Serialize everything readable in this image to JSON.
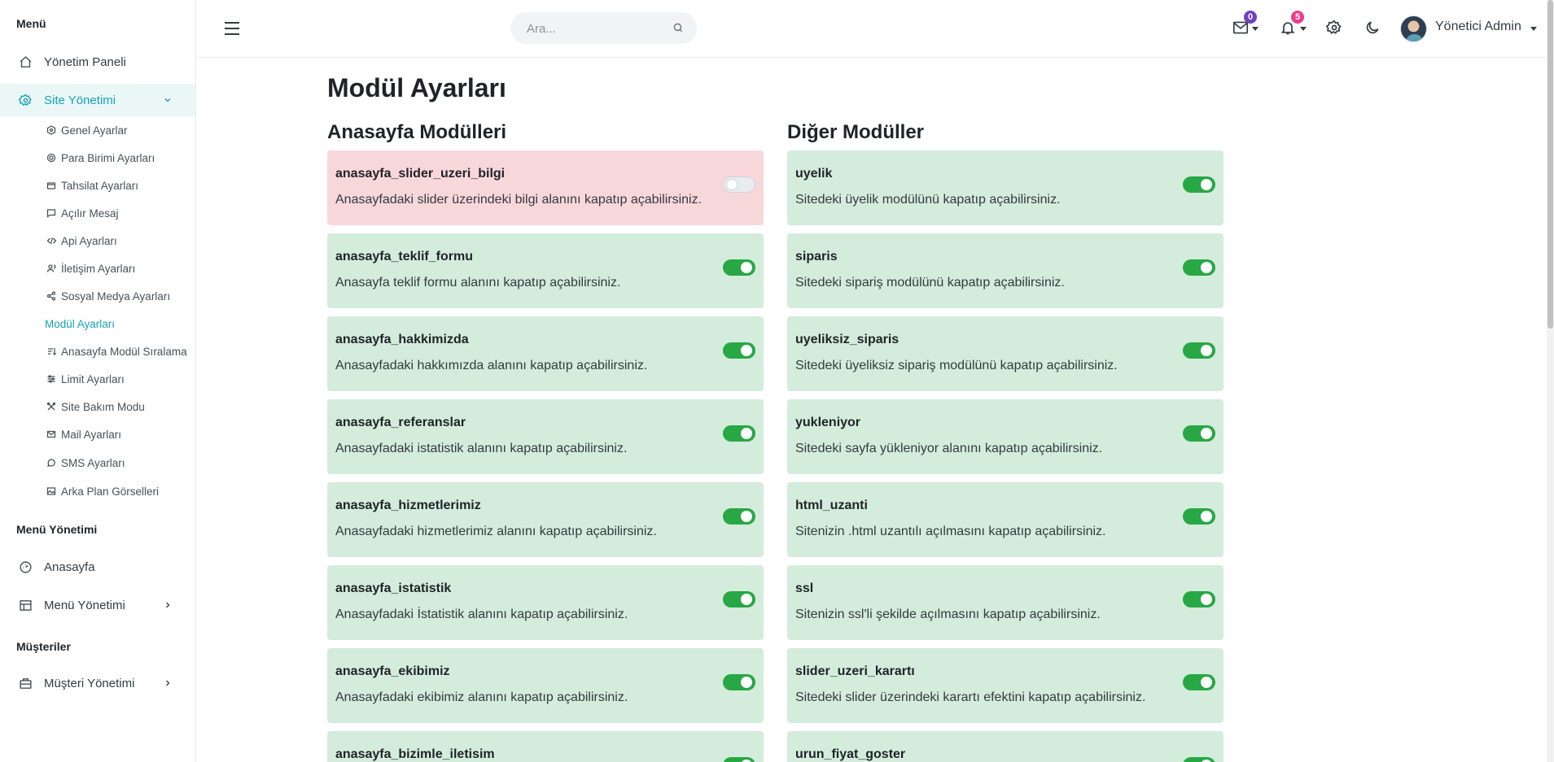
{
  "sidebar": {
    "section_menu": "Menü",
    "dashboard": "Yönetim Paneli",
    "site_management": "Site Yönetimi",
    "sub_items": [
      {
        "label": "Genel Ayarlar",
        "icon": "settings-icon"
      },
      {
        "label": "Para Birimi Ayarları",
        "icon": "currency-icon"
      },
      {
        "label": "Tahsilat Ayarları",
        "icon": "folder-icon"
      },
      {
        "label": "Açılır Mesaj",
        "icon": "message-icon"
      },
      {
        "label": "Api Ayarları",
        "icon": "code-icon"
      },
      {
        "label": "İletişim Ayarları",
        "icon": "users-icon"
      },
      {
        "label": "Sosyal Medya Ayarları",
        "icon": "share-icon"
      },
      {
        "label": "Modül Ayarları",
        "icon": "",
        "active": true
      },
      {
        "label": "Anasayfa Modül Sıralama",
        "icon": "sort-icon"
      },
      {
        "label": "Limit Ayarları",
        "icon": "sliders-icon"
      },
      {
        "label": "Site Bakım Modu",
        "icon": "tools-icon"
      },
      {
        "label": "Mail Ayarları",
        "icon": "mail-icon"
      },
      {
        "label": "SMS Ayarları",
        "icon": "chat-icon"
      },
      {
        "label": "Arka Plan Görselleri",
        "icon": "image-icon"
      }
    ],
    "section_menu_management": "Menü Yönetimi",
    "homepage": "Anasayfa",
    "menu_management": "Menü Yönetimi",
    "section_customers": "Müşteriler",
    "customer_management": "Müşteri Yönetimi"
  },
  "header": {
    "search_placeholder": "Ara...",
    "messages_count": "0",
    "notifications_count": "5",
    "user_name": "Yönetici Admin"
  },
  "colors": {
    "accent": "#17a2b8",
    "enabled_card": "#d4ecdc",
    "disabled_card": "#f8d7db",
    "toggle_on": "#28a745",
    "badge_messages": "#6f42c1",
    "badge_notifications": "#e83e8c"
  },
  "page": {
    "title": "Modül Ayarları",
    "left_title": "Anasayfa Modülleri",
    "right_title": "Diğer Modüller"
  },
  "left_modules": [
    {
      "key": "anasayfa_slider_uzeri_bilgi",
      "desc": "Anasayfadaki slider üzerindeki bilgi alanını kapatıp açabilirsiniz.",
      "enabled": false
    },
    {
      "key": "anasayfa_teklif_formu",
      "desc": "Anasayfa teklif formu alanını kapatıp açabilirsiniz.",
      "enabled": true
    },
    {
      "key": "anasayfa_hakkimizda",
      "desc": "Anasayfadaki hakkımızda alanını kapatıp açabilirsiniz.",
      "enabled": true
    },
    {
      "key": "anasayfa_referanslar",
      "desc": "Anasayfadaki istatistik alanını kapatıp açabilirsiniz.",
      "enabled": true
    },
    {
      "key": "anasayfa_hizmetlerimiz",
      "desc": "Anasayfadaki hizmetlerimiz alanını kapatıp açabilirsiniz.",
      "enabled": true
    },
    {
      "key": "anasayfa_istatistik",
      "desc": "Anasayfadaki İstatistik alanını kapatıp açabilirsiniz.",
      "enabled": true
    },
    {
      "key": "anasayfa_ekibimiz",
      "desc": "Anasayfadaki ekibimiz alanını kapatıp açabilirsiniz.",
      "enabled": true
    },
    {
      "key": "anasayfa_bizimle_iletisim",
      "desc": "",
      "enabled": true
    }
  ],
  "right_modules": [
    {
      "key": "uyelik",
      "desc": "Sitedeki üyelik modülünü kapatıp açabilirsiniz.",
      "enabled": true
    },
    {
      "key": "siparis",
      "desc": "Sitedeki sipariş modülünü kapatıp açabilirsiniz.",
      "enabled": true
    },
    {
      "key": "uyeliksiz_siparis",
      "desc": "Sitedeki üyeliksiz sipariş modülünü kapatıp açabilirsiniz.",
      "enabled": true
    },
    {
      "key": "yukleniyor",
      "desc": "Sitedeki sayfa yükleniyor alanını kapatıp açabilirsiniz.",
      "enabled": true
    },
    {
      "key": "html_uzanti",
      "desc": "Sitenizin .html uzantılı açılmasını kapatıp açabilirsiniz.",
      "enabled": true
    },
    {
      "key": "ssl",
      "desc": "Sitenizin ssl'li şekilde açılmasını kapatıp açabilirsiniz.",
      "enabled": true
    },
    {
      "key": "slider_uzeri_karartı",
      "desc": "Sitedeki slider üzerindeki karartı efektini kapatıp açabilirsiniz.",
      "enabled": true
    },
    {
      "key": "urun_fiyat_goster",
      "desc": "",
      "enabled": true
    }
  ]
}
